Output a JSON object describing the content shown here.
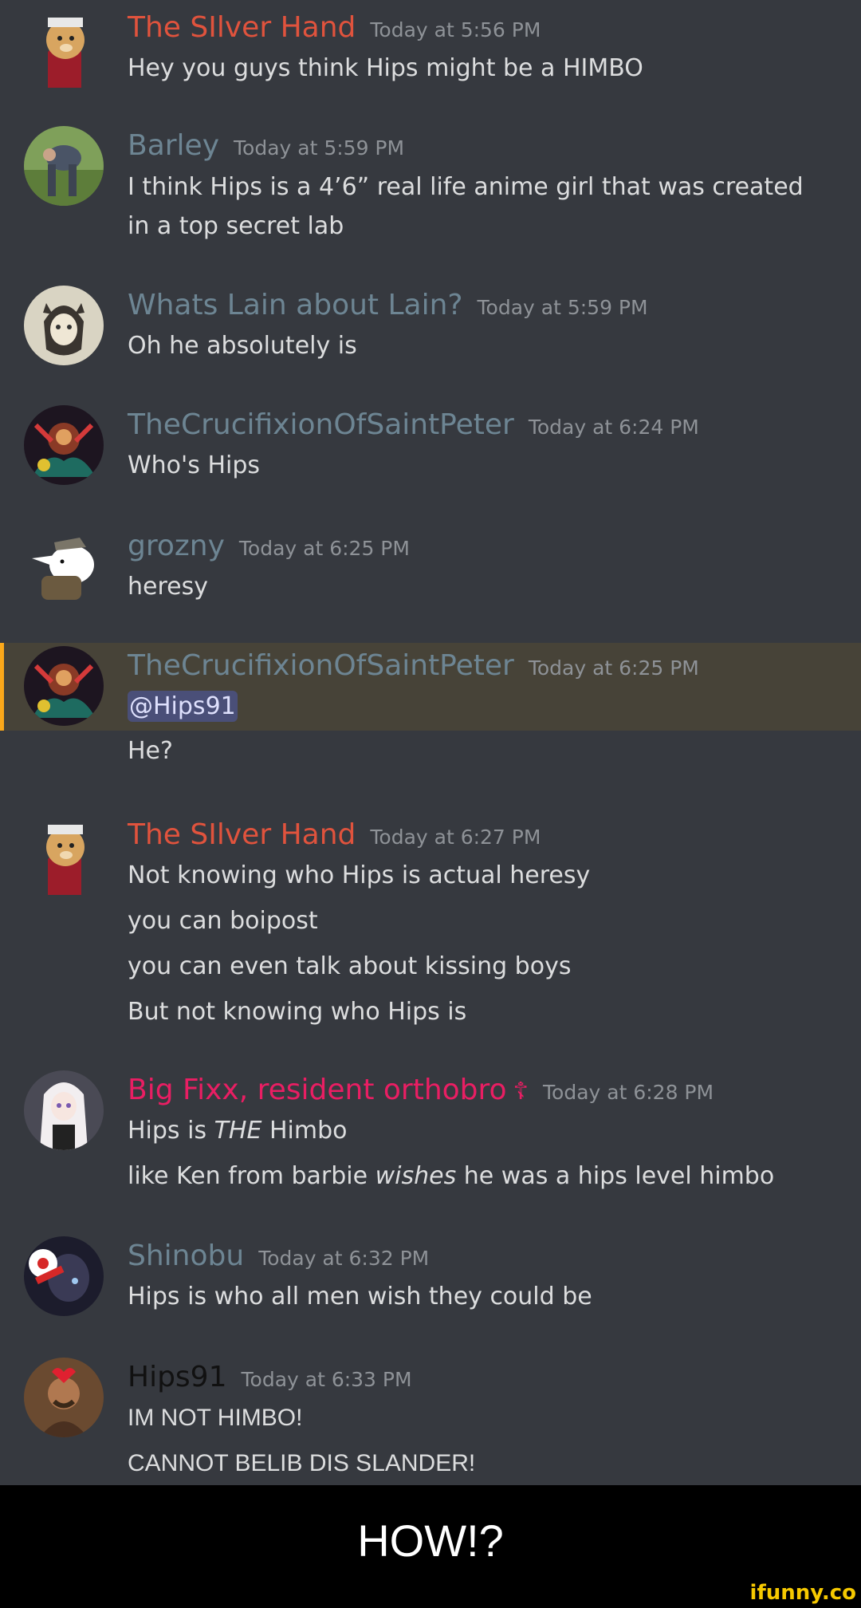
{
  "messages": [
    {
      "author": "The SIlver Hand",
      "time": "Today at 5:56 PM",
      "lines": [
        "Hey you guys think Hips might be a HIMBO"
      ]
    },
    {
      "author": "Barley",
      "time": "Today at 5:59 PM",
      "lines": [
        "I think Hips is a 4’6” real life anime girl that was created in a top secret lab"
      ]
    },
    {
      "author": "Whats Lain about Lain?",
      "time": "Today at 5:59 PM",
      "lines": [
        "Oh he absolutely is"
      ]
    },
    {
      "author": "TheCrucifixionOfSaintPeter",
      "time": "Today at 6:24 PM",
      "lines": [
        "Who's Hips"
      ]
    },
    {
      "author": "grozny",
      "time": "Today at 6:25 PM",
      "lines": [
        "heresy"
      ]
    },
    {
      "author": "TheCrucifixionOfSaintPeter",
      "time": "Today at 6:25 PM",
      "mention": "@Hips91",
      "lines": [
        "He?"
      ]
    },
    {
      "author": "The SIlver Hand",
      "time": "Today at 6:27 PM",
      "lines": [
        "Not knowing who Hips is actual heresy",
        "you can boipost",
        "you can even talk about kissing boys",
        "But not knowing who Hips is"
      ]
    },
    {
      "author": "Big Fixx, resident orthobro",
      "author_suffix": "☦",
      "time": "Today at 6:28 PM",
      "line1": {
        "a": "Hips is ",
        "em": "THE",
        "b": " Himbo"
      },
      "line2": {
        "a": "like Ken from barbie ",
        "em": "wishes",
        "b": " he was a hips level himbo"
      }
    },
    {
      "author": "Shinobu",
      "time": "Today at 6:32 PM",
      "lines": [
        "Hips is who all men wish they could be"
      ]
    },
    {
      "author": "Hips91",
      "time": "Today at 6:33 PM",
      "lines": [
        "IM NOT HIMBO!",
        "CANNOT BELIB DIS SLANDER!"
      ]
    }
  ],
  "colors": {
    "background": "#36393f",
    "silver_hand": "#e0533d",
    "default_name": "#6d8593",
    "big_fixx": "#e91e63",
    "hips91": "#111111",
    "mention_highlight": "#474338",
    "mention_bar": "#faa81a"
  },
  "avatar_icons": [
    "doge-avatar",
    "photo-avatar",
    "anime-sketch-avatar",
    "fantasy-art-avatar",
    "cartoon-avatar",
    "fantasy-art-avatar",
    "doge-avatar",
    "anime-girl-avatar",
    "shinobu-avatar",
    "hips91-avatar"
  ],
  "footer": {
    "caption": "HOW!?",
    "watermark": "ifunny.co"
  }
}
